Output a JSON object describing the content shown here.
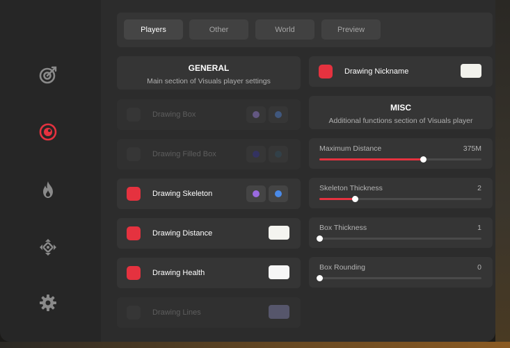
{
  "sidebar": {
    "items": [
      {
        "icon": "aim-target-icon"
      },
      {
        "icon": "eye-icon",
        "active": true
      },
      {
        "icon": "flame-icon"
      },
      {
        "icon": "move-arrows-icon"
      },
      {
        "icon": "gear-icon"
      }
    ]
  },
  "tabs": [
    {
      "label": "Players",
      "active": true
    },
    {
      "label": "Other"
    },
    {
      "label": "World"
    },
    {
      "label": "Preview"
    }
  ],
  "general": {
    "title": "GENERAL",
    "subtitle": "Main section of Visuals player settings"
  },
  "misc": {
    "title": "MISC",
    "subtitle": "Additional functions section of Visuals player"
  },
  "options": [
    {
      "label": "Drawing Box",
      "enabled": false,
      "colors": [
        "#a78be8",
        "#5a8de0"
      ]
    },
    {
      "label": "Drawing Filled Box",
      "enabled": false,
      "colors": [
        "#3d3aa0",
        "#3a5a6a"
      ]
    },
    {
      "label": "Drawing Skeleton",
      "enabled": true,
      "colors": [
        "#9a6ae0",
        "#4a8ae8"
      ]
    },
    {
      "label": "Drawing Distance",
      "enabled": true,
      "swatch": "#f4f4f0"
    },
    {
      "label": "Drawing Health",
      "enabled": true,
      "swatch": "#f6f6f6"
    },
    {
      "label": "Drawing Lines",
      "enabled": false,
      "swatch": "#8a8ab8"
    }
  ],
  "nickname": {
    "label": "Drawing Nickname",
    "enabled": true,
    "swatch": "#f2f2ec"
  },
  "sliders": [
    {
      "label": "Maximum Distance",
      "value_text": "375M",
      "fraction": 0.64
    },
    {
      "label": "Skeleton Thickness",
      "value_text": "2",
      "fraction": 0.22
    },
    {
      "label": "Box Thickness",
      "value_text": "1",
      "fraction": 0.0
    },
    {
      "label": "Box Rounding",
      "value_text": "0",
      "fraction": 0.0
    }
  ],
  "colors": {
    "accent": "#e5323f",
    "panel": "#353535",
    "sidebar": "#262626"
  }
}
